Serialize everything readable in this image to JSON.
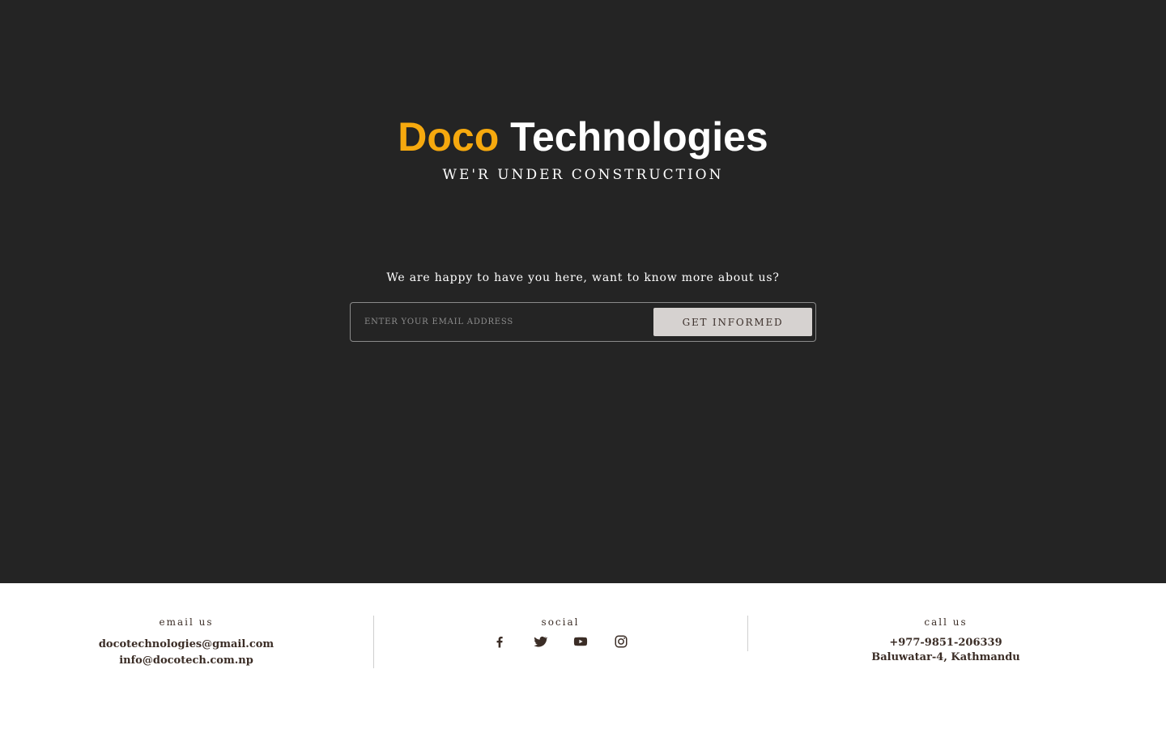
{
  "hero": {
    "brand_accent": "Doco",
    "brand_rest": "Technologies",
    "tagline": "WE'R UNDER CONSTRUCTION",
    "intro": "We are happy to have you here, want to know more about us?",
    "email_placeholder": "ENTER YOUR EMAIL ADDRESS",
    "submit_label": "GET INFORMED"
  },
  "footer": {
    "email": {
      "heading": "email us",
      "lines": [
        "docotechnologies@gmail.com",
        "info@docotech.com.np"
      ]
    },
    "social": {
      "heading": "social",
      "icons": [
        "facebook-icon",
        "twitter-icon",
        "youtube-icon",
        "instagram-icon"
      ]
    },
    "call": {
      "heading": "call us",
      "phone": "+977-9851-206339",
      "address": "Baluwatar-4, Kathmandu"
    }
  },
  "colors": {
    "hero_background": "#242424",
    "brand_accent": "#f6a90e",
    "footer_text": "#3b2d26",
    "button_background": "#d6d2d0"
  }
}
